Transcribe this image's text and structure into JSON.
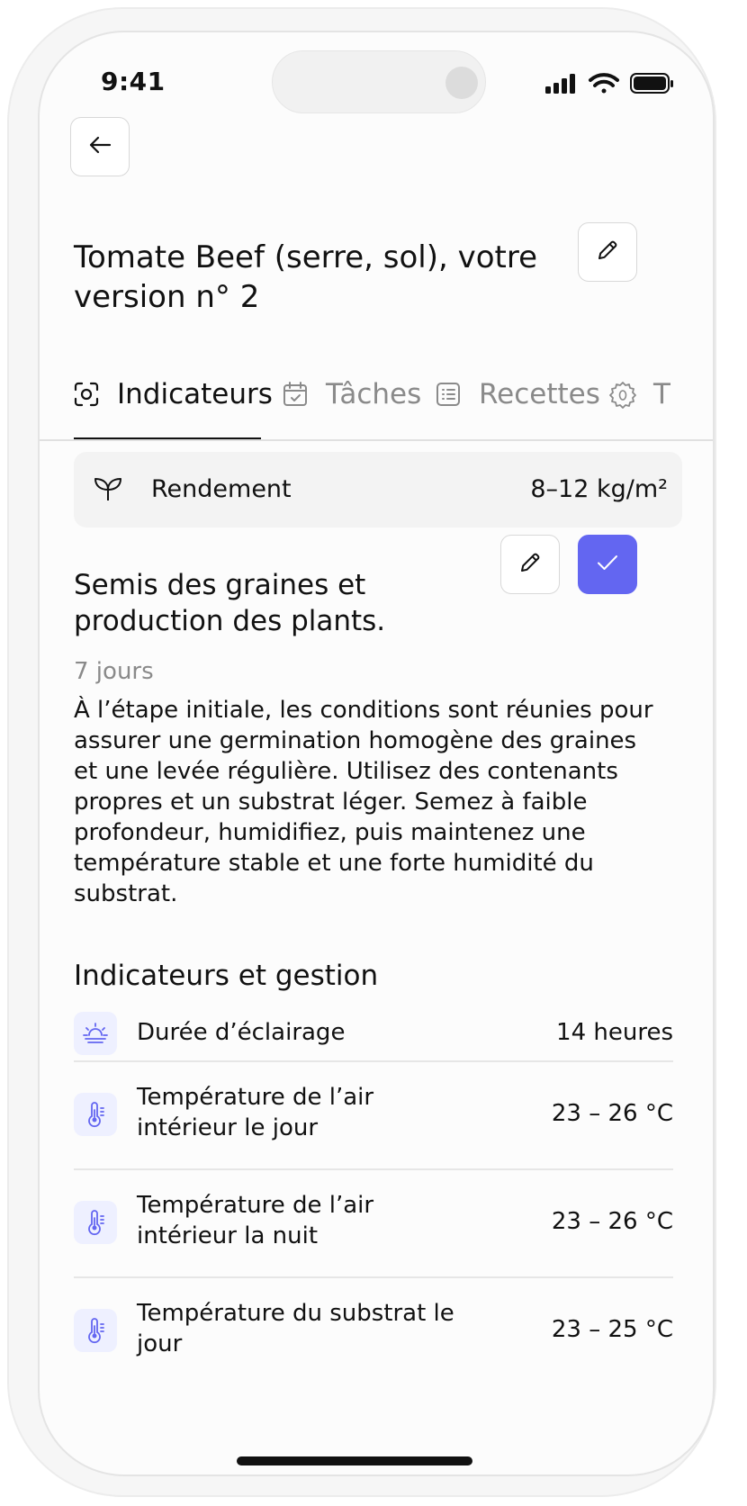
{
  "status_bar": {
    "time": "9:41"
  },
  "header": {
    "title": "Tomate Beef (serre, sol), votre version n° 2"
  },
  "tabs": [
    {
      "label": "Indicateurs",
      "icon": "scan-icon",
      "active": true
    },
    {
      "label": "Tâches",
      "icon": "calendar-check-icon",
      "active": false
    },
    {
      "label": "Recettes",
      "icon": "list-icon",
      "active": false
    },
    {
      "label": "T",
      "icon": "bug-icon",
      "active": false
    }
  ],
  "yield": {
    "label": "Rendement",
    "value": "8–12 kg/m²",
    "icon": "sprout-icon"
  },
  "stage": {
    "title": "Semis des graines et production des plants.",
    "duration": "7 jours",
    "description": "À l’étape initiale, les conditions sont réunies pour assurer une germination homogène des graines et une levée régulière. Utilisez des contenants propres et un substrat léger. Semez à faible profondeur, humidifiez, puis maintenez une température stable et une forte humidité du substrat."
  },
  "indicators": {
    "title": "Indicateurs et gestion",
    "items": [
      {
        "name": "Durée d’éclairage",
        "value": "14 heures",
        "icon": "sunrise-icon"
      },
      {
        "name": "Température de l’air intérieur le jour",
        "value": "23 – 26 °C",
        "icon": "thermometer-icon"
      },
      {
        "name": "Température de l’air intérieur la nuit",
        "value": "23 – 26 °C",
        "icon": "thermometer-icon"
      },
      {
        "name": "Température du substrat le jour",
        "value": "23 – 25 °C",
        "icon": "thermometer-icon"
      }
    ]
  },
  "colors": {
    "accent": "#6366f1",
    "icon_bg": "#eef0ff",
    "muted": "#8a8a8a"
  }
}
